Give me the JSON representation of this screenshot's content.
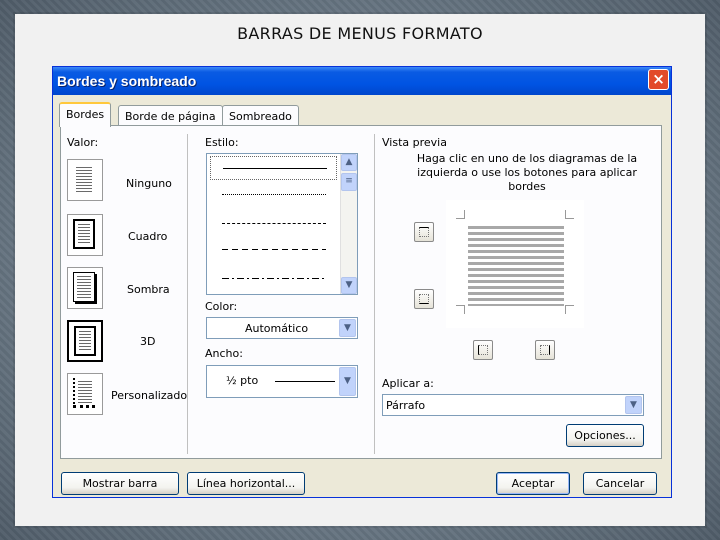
{
  "slide": {
    "title": "BARRAS DE MENUS FORMATO"
  },
  "dialog": {
    "title": "Bordes y sombreado",
    "close_label": "×",
    "tabs": [
      {
        "label": "Bordes",
        "active": true
      },
      {
        "label": "Borde de página",
        "active": false
      },
      {
        "label": "Sombreado",
        "active": false
      }
    ]
  },
  "valor": {
    "label": "Valor:",
    "items": [
      {
        "label": "Ninguno",
        "icon": "setting-none-icon"
      },
      {
        "label": "Cuadro",
        "icon": "setting-box-icon"
      },
      {
        "label": "Sombra",
        "icon": "setting-shadow-icon"
      },
      {
        "label": "3D",
        "icon": "setting-3d-icon"
      },
      {
        "label": "Personalizado",
        "icon": "setting-custom-icon"
      }
    ]
  },
  "estilo": {
    "label": "Estilo:",
    "styles": [
      "solid",
      "dotted",
      "dashed-short",
      "dashed-long",
      "dash-dot"
    ]
  },
  "color": {
    "label": "Color:",
    "value": "Automático"
  },
  "ancho": {
    "label": "Ancho:",
    "value": "½ pto"
  },
  "vista_previa": {
    "label": "Vista previa",
    "hint": "Haga clic en uno de los diagramas de la izquierda o use los botones para aplicar bordes"
  },
  "aplicar": {
    "label": "Aplicar a:",
    "value": "Párrafo"
  },
  "buttons": {
    "opciones": "Opciones...",
    "mostrar_barra": "Mostrar barra",
    "linea_horizontal": "Línea horizontal...",
    "aceptar": "Aceptar",
    "cancelar": "Cancelar"
  },
  "colors": {
    "titlebar": "#0054e3",
    "dialog_bg": "#ece9d8",
    "close": "#e24a2a",
    "active_tab_accent": "#ffc83c"
  }
}
